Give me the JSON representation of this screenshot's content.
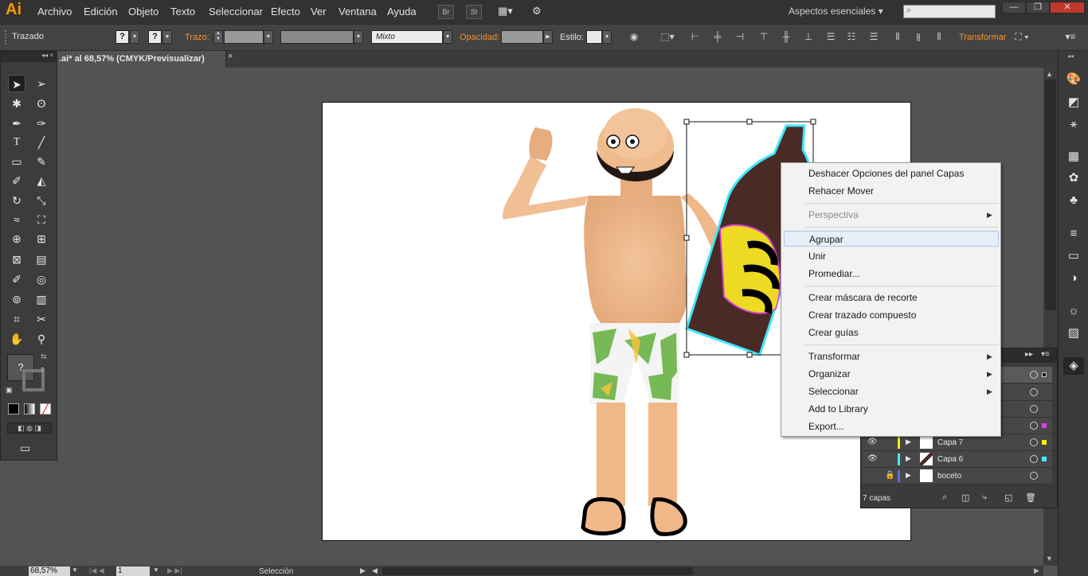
{
  "app": {
    "logo": "Ai"
  },
  "menubar": {
    "items": [
      "Archivo",
      "Edición",
      "Objeto",
      "Texto",
      "Seleccionar",
      "Efecto",
      "Ver",
      "Ventana",
      "Ayuda"
    ],
    "br": "Br",
    "st": "St",
    "workspace": "Aspectos esenciales",
    "workspace_arrow": "▾",
    "search_icon": "search-icon"
  },
  "window": {
    "min": "—",
    "restore": "❐",
    "close": "✕"
  },
  "control": {
    "object_type": "Trazado",
    "fill_q": "?",
    "stroke_q": "?",
    "stroke_label": "Trazo:",
    "blend_mode": "Mixto",
    "opacity_label": "Opacidad:",
    "style_label": "Estilo:",
    "transform_label": "Transformar"
  },
  "document": {
    "tab_title": ".ai* al 68,57% (CMYK/Previsualizar)",
    "tab_close": "×"
  },
  "tools_panel": {
    "header": "◂◂ ×",
    "fill_q": "?",
    "stroke_q": "?"
  },
  "context_menu": {
    "items": [
      {
        "label": "Deshacer Opciones del panel Capas"
      },
      {
        "label": "Rehacer Mover"
      },
      {
        "label": "Perspectiva",
        "disabled": true,
        "submenu": true
      },
      {
        "label": "Agrupar",
        "highlighted": true
      },
      {
        "label": "Unir"
      },
      {
        "label": "Promediar..."
      },
      {
        "label": "Crear máscara de recorte"
      },
      {
        "label": "Crear trazado compuesto"
      },
      {
        "label": "Crear guías"
      },
      {
        "label": "Transformar",
        "submenu": true
      },
      {
        "label": "Organizar",
        "submenu": true
      },
      {
        "label": "Seleccionar",
        "submenu": true
      },
      {
        "label": "Add to Library"
      },
      {
        "label": "Export..."
      }
    ],
    "submenu_arrow": "▶"
  },
  "layers_panel": {
    "header_arrows": "▸▸",
    "menu_icon": "▾≡",
    "rows": [
      {
        "name": "Capa 7",
        "color": "#ffee00",
        "swatch": "#ffee00"
      },
      {
        "name": "Capa 6",
        "color": "#44e8ff",
        "swatch": "#44e8ff"
      },
      {
        "name": "boceto",
        "color": "#5570e8",
        "swatch": ""
      }
    ],
    "count": "7 capas"
  },
  "status": {
    "zoom": "68,57%",
    "page": "1",
    "tool": "Selección"
  },
  "colors": {
    "accent_orange": "#f5912d",
    "selection_cyan": "#3fe6ff",
    "selection_magenta": "#e040e0",
    "selection_yellow": "#ffee22",
    "bottle_brown": "#4a2a24"
  }
}
